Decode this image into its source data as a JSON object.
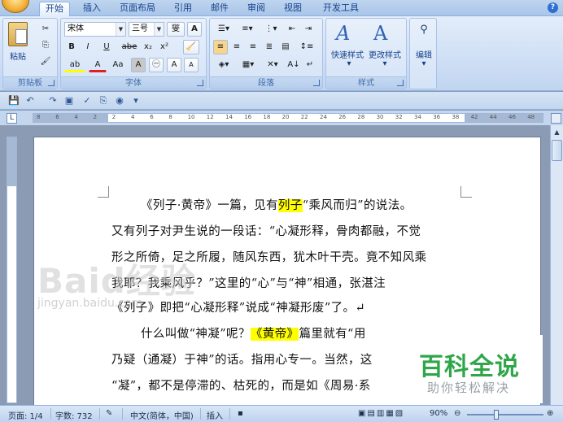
{
  "tabs": [
    "开始",
    "插入",
    "页面布局",
    "引用",
    "邮件",
    "审阅",
    "视图",
    "开发工具"
  ],
  "active_tab": "开始",
  "ribbon": {
    "clipboard": {
      "label": "剪贴板",
      "paste": "粘贴"
    },
    "font": {
      "label": "字体",
      "font_name": "宋体",
      "font_size": "三号",
      "wen_btn": "燮",
      "a_btn": "A",
      "bold": "B",
      "italic": "I",
      "underline": "U",
      "strike": "abe",
      "sub": "x₂",
      "sup": "x²",
      "case": "Aa",
      "clear": "A",
      "char_shade": "A",
      "enclose": "㊀",
      "grow": "A",
      "shrink": "A"
    },
    "paragraph": {
      "label": "段落"
    },
    "styles": {
      "label": "样式",
      "quick_styles": "快速样式",
      "change_styles": "更改样式"
    },
    "editing": {
      "label": "编辑"
    }
  },
  "ruler": {
    "ticks": [
      "8",
      "6",
      "4",
      "2",
      "2",
      "4",
      "6",
      "8",
      "10",
      "12",
      "14",
      "16",
      "18",
      "20",
      "22",
      "24",
      "26",
      "28",
      "30",
      "32",
      "34",
      "36",
      "38",
      "42",
      "44",
      "46",
      "48"
    ]
  },
  "document": {
    "lines": [
      {
        "pre": "《列子·黄帝》一篇，见有",
        "hl": "列子",
        "post": "“乘风而归”的说法。"
      },
      {
        "pre": "又有列子对尹生说的一段话：“心凝形释，骨肉都融，不觉",
        "hl": "",
        "post": ""
      },
      {
        "pre": "形之所倚，足之所履，随风东西，犹木叶干壳。竟不知风乘",
        "hl": "",
        "post": ""
      },
      {
        "pre": "我耶？我乘风乎？”这里的“心”与“神”相通，张湛注",
        "hl": "",
        "post": ""
      },
      {
        "pre": "《列子》即把“心凝形释”说成“神凝形废”了。↵",
        "hl": "",
        "post": ""
      },
      {
        "pre": "什么叫做“神凝”呢？",
        "hl": "《黄帝》",
        "post": "篇里就有“用"
      },
      {
        "pre": "乃疑（通凝）于神”的话。指用心专一。当然，这",
        "hl": "",
        "post": ""
      },
      {
        "pre": "“凝”，都不是停滞的、枯死的，而是如《周易·系",
        "hl": "",
        "post": ""
      }
    ]
  },
  "status": {
    "page": "页面: 1/4",
    "words": "字数: 732",
    "language": "中文(简体，中国)",
    "mode": "插入",
    "zoom": "90%"
  },
  "watermark": {
    "baidu": "Baid经验",
    "jingyan": "jingyan.baidu.com",
    "badge_title": "百科全说",
    "badge_sub": "助你轻松解决"
  }
}
